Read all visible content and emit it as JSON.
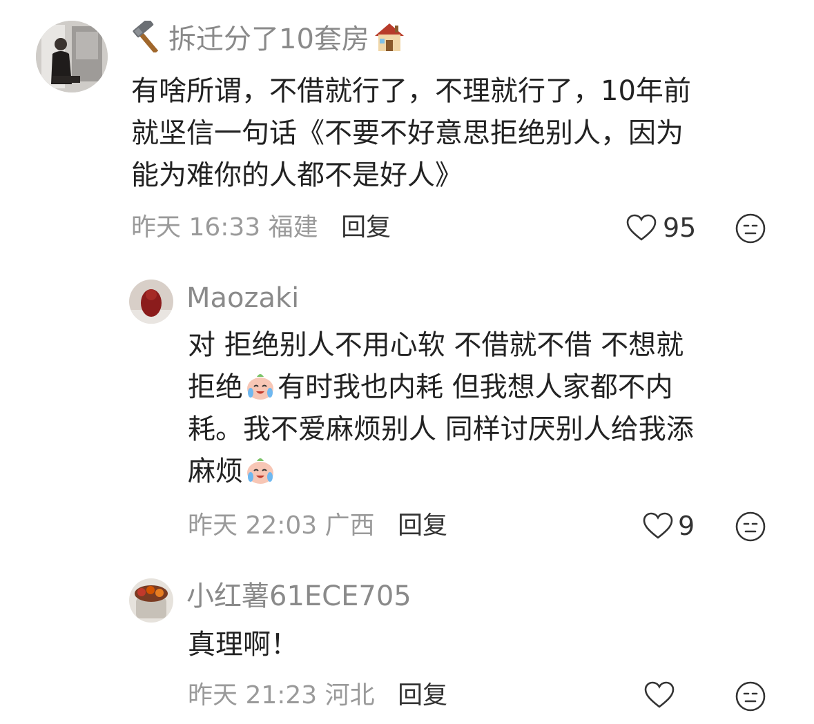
{
  "comments": [
    {
      "username": "拆迁分了10套房",
      "username_prefix_icon": "hammer-icon",
      "username_suffix_icon": "house-icon",
      "lines": [
        "有啥所谓，不借就行了，不理就行了，10年前",
        "就坚信一句话《不要不好意思拒绝别人，因为",
        "能为难你的人都不是好人》"
      ],
      "time": "昨天 16:33",
      "location": "福建",
      "reply_label": "回复",
      "likes": "95"
    },
    {
      "username": "Maozaki",
      "lines": [
        {
          "before": "对  拒绝别人不用心软 不借就不借 不想就",
          "after": ""
        },
        {
          "before": "拒绝",
          "after": "有时我也内耗 但我想人家都不内"
        },
        {
          "before": "耗。我不爱麻烦别人 同样讨厌别人给我添",
          "after": ""
        },
        {
          "before": "麻烦",
          "after": ""
        }
      ],
      "inline_emoji": "crying-laughing-emoji-icon",
      "time": "昨天 22:03",
      "location": "广西",
      "reply_label": "回复",
      "likes": "9"
    },
    {
      "username": "小红薯61ECE705",
      "lines": [
        "真理啊！"
      ],
      "time": "昨天 21:23",
      "location": "河北",
      "reply_label": "回复",
      "likes": ""
    }
  ],
  "colors": {
    "username": "#8a8a8a",
    "body_text": "#222222",
    "meta": "#9a9a9a",
    "reply": "#333333",
    "background": "#ffffff"
  }
}
